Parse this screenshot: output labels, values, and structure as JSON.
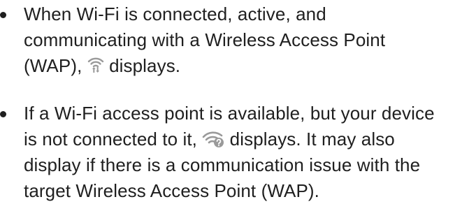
{
  "items": [
    {
      "line1": "When Wi-Fi is connected, active, and",
      "line2": "communicating with a Wireless Access Point",
      "line3_before": "(WAP),",
      "line3_after": "displays.",
      "icon": "wifi-active-icon"
    },
    {
      "line1": "If a Wi-Fi access point is available, but your device",
      "line2_before": "is not connected to it,",
      "line2_after": "displays. It may also",
      "line3": "display if there is a communication issue with the",
      "line4": "target Wireless Access Point (WAP).",
      "icon": "wifi-available-question-icon"
    }
  ],
  "colors": {
    "text": "#1f1f1f",
    "icon": "#9a9a9a"
  }
}
